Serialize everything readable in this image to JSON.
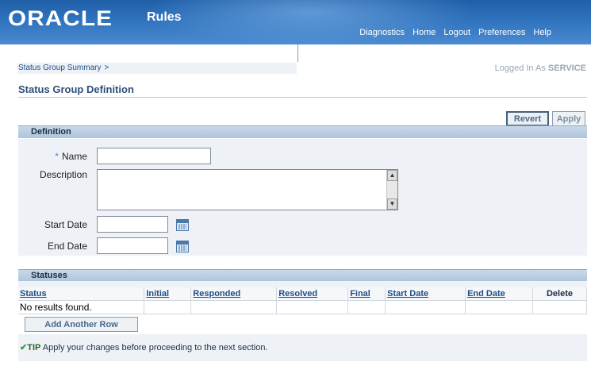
{
  "header": {
    "logo": "ORACLE",
    "app_name": "Rules",
    "nav": [
      "Diagnostics",
      "Home",
      "Logout",
      "Preferences",
      "Help"
    ]
  },
  "breadcrumb": {
    "item": "Status Group Summary",
    "separator": ">"
  },
  "logged_in": {
    "prefix": "Logged In As",
    "user": "SERVICE"
  },
  "page_title": "Status Group Definition",
  "buttons": {
    "revert": "Revert",
    "apply": "Apply",
    "add_row": "Add Another Row"
  },
  "definition": {
    "header": "Definition",
    "required_marker": "*",
    "name_label": "Name",
    "description_label": "Description",
    "start_date_label": "Start Date",
    "end_date_label": "End Date",
    "name_value": "",
    "description_value": "",
    "start_date_value": "",
    "end_date_value": ""
  },
  "statuses": {
    "header": "Statuses",
    "columns": [
      "Status",
      "Initial",
      "Responded",
      "Resolved",
      "Final",
      "Start Date",
      "End Date",
      "Delete"
    ],
    "empty_message": "No results found."
  },
  "tip": {
    "marker": "✔",
    "label": "TIP",
    "text": "Apply your changes before proceeding to the next section."
  },
  "icons": {
    "calendar": "calendar-icon",
    "scroll_up": "scroll-up-icon",
    "scroll_down": "scroll-down-icon"
  }
}
